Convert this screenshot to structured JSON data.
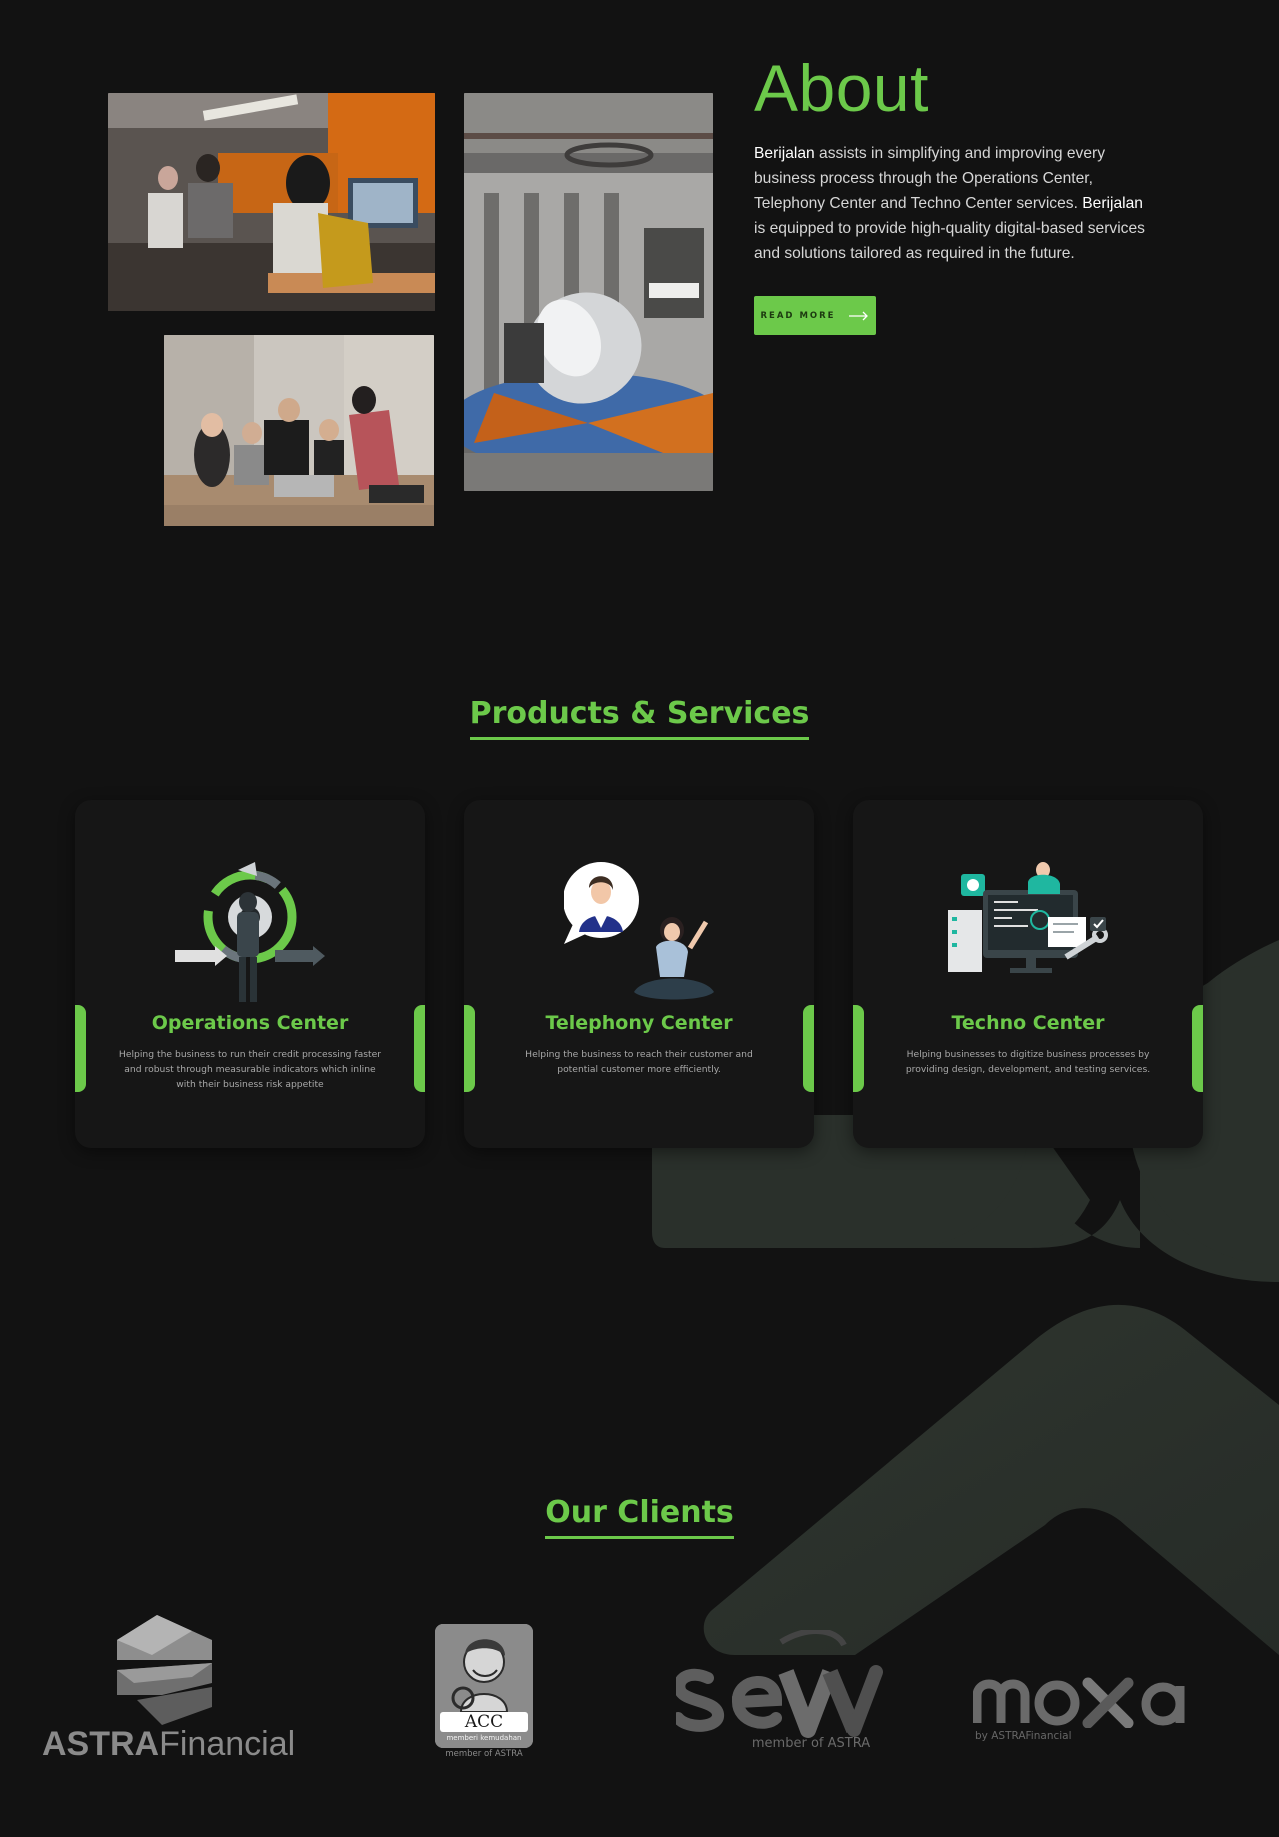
{
  "about": {
    "title": "About",
    "brand": "Berijalan",
    "text_part1": " assists in simplifying and improving every business process through the Operations Center, Telephony Center and Techno Center services. ",
    "brand2": "Berijalan",
    "text_part2": " is equipped to provide high-quality digital-based services and solutions tailored as required in the future.",
    "read_more_label": "READ MORE",
    "photos": [
      {
        "name": "call-center-photo"
      },
      {
        "name": "lounge-pod-photo"
      },
      {
        "name": "team-meeting-photo"
      }
    ]
  },
  "services": {
    "title": "Products & Services",
    "items": [
      {
        "title": "Operations Center",
        "desc": "Helping the business to run their credit processing faster and robust through measurable indicators which inline with their business risk appetite",
        "icon": "operations-illustration"
      },
      {
        "title": "Telephony Center",
        "desc": "Helping the business to reach their customer and potential customer more efficiently.",
        "icon": "telephony-illustration"
      },
      {
        "title": "Techno Center",
        "desc": "Helping businesses to digitize business processes by providing design, development, and testing services.",
        "icon": "techno-illustration"
      }
    ]
  },
  "clients": {
    "title": "Our Clients",
    "items": [
      {
        "name": "ASTRA Financial",
        "word1": "ASTRA",
        "word2": "Financial"
      },
      {
        "name": "ACC",
        "tagline": "memberi kemudahan",
        "member": "member of ASTRA",
        "mark": "ACC"
      },
      {
        "name": "seva",
        "member": "member of ASTRA"
      },
      {
        "name": "moxa",
        "member": "by ASTRAFinancial"
      }
    ]
  },
  "colors": {
    "background": "#121212",
    "accent": "#6cc94a",
    "card": "#161616"
  }
}
